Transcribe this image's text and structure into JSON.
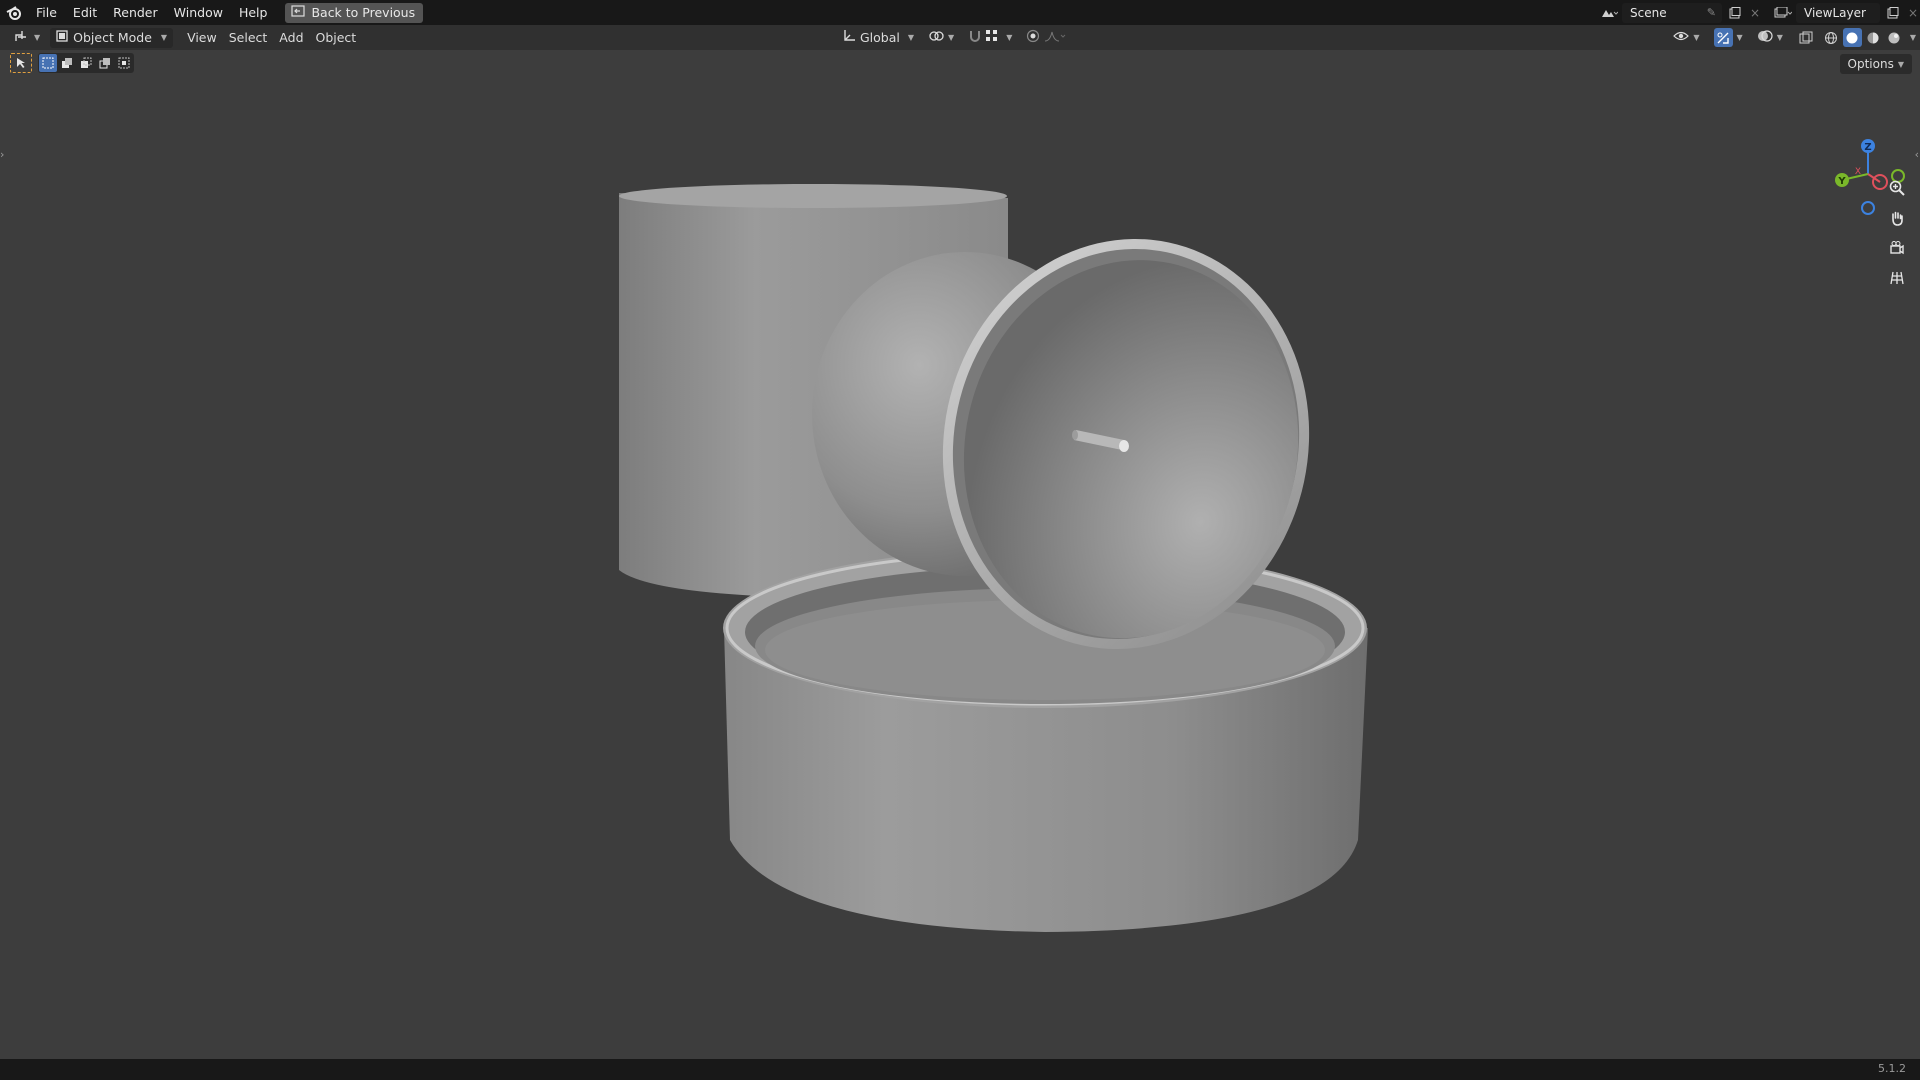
{
  "menu": {
    "items": [
      "File",
      "Edit",
      "Render",
      "Window",
      "Help"
    ],
    "back_button": "Back to Previous"
  },
  "topbar_right": {
    "scene_label": "Scene",
    "view_layer_label": "ViewLayer"
  },
  "header": {
    "mode": "Object Mode",
    "menus": [
      "View",
      "Select",
      "Add",
      "Object"
    ],
    "transform_orientation": "Global"
  },
  "viewport": {
    "options_label": "Options",
    "gizmo_axes": {
      "z": "Z",
      "y": "Y",
      "x": "X"
    }
  },
  "status": {
    "version": "5.1.2"
  },
  "colors": {
    "accent_blue": "#4772b3",
    "axis_x": "#e0505c",
    "axis_y": "#7ab82a",
    "axis_z": "#3c82e0",
    "viewport_bg": "#3d3d3d"
  },
  "icons": [
    "blender-logo-icon",
    "back-icon",
    "editor-type-icon",
    "object-mode-icon",
    "orientation-icon",
    "pivot-icon",
    "snap-icon",
    "proportional-icon",
    "visibility-icon",
    "gizmo-icon",
    "overlay-icon",
    "xray-icon",
    "wireframe-icon",
    "solid-icon",
    "material-icon",
    "rendered-icon",
    "zoom-icon",
    "hand-icon",
    "camera-icon",
    "grid-icon",
    "select-box-icon"
  ]
}
